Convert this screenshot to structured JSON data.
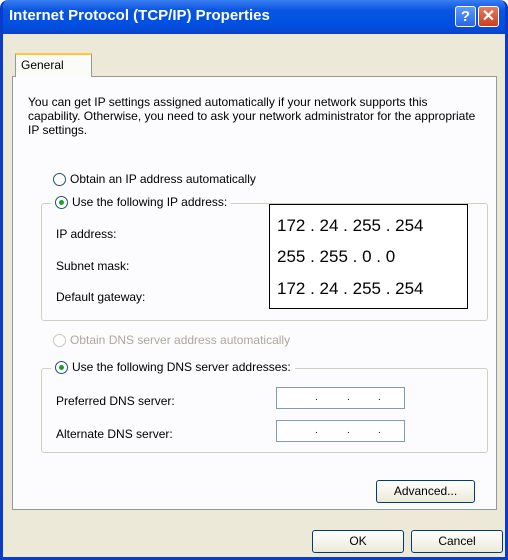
{
  "window": {
    "title": "Internet Protocol (TCP/IP) Properties",
    "help_glyph": "?",
    "close_glyph": "✕"
  },
  "tab": {
    "label": "General"
  },
  "description": "You can get IP settings assigned automatically if your network supports this capability. Otherwise, you need to ask your network administrator for the appropriate IP settings.",
  "ip_section": {
    "auto_label": "Obtain an IP address automatically",
    "manual_label": "Use the following IP address:",
    "ip_label": "IP address:",
    "subnet_label": "Subnet mask:",
    "gateway_label": "Default gateway:",
    "ip_value": "172 . 24 . 255 . 254",
    "subnet_value": "255 . 255 . 0 . 0",
    "gateway_value": "172 . 24 . 255 . 254"
  },
  "dns_section": {
    "auto_label": "Obtain DNS server address automatically",
    "manual_label": "Use the following DNS server addresses:",
    "preferred_label": "Preferred DNS server:",
    "alternate_label": "Alternate DNS server:",
    "dot": "."
  },
  "buttons": {
    "advanced": "Advanced...",
    "ok": "OK",
    "cancel": "Cancel"
  }
}
